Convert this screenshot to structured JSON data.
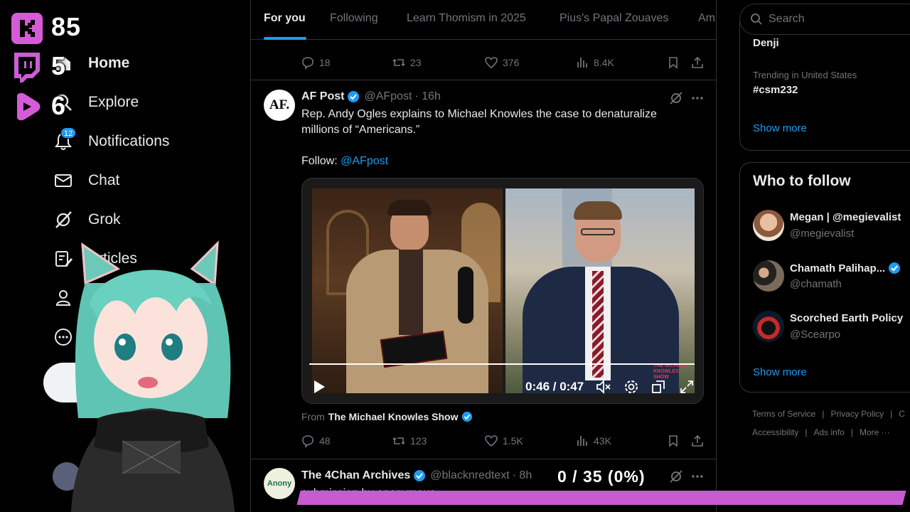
{
  "overlay": {
    "counters": [
      {
        "icon": "kick-icon",
        "color": "#d65bd8",
        "value": "85"
      },
      {
        "icon": "twitch-icon",
        "color": "#c95fd3",
        "value": "5"
      },
      {
        "icon": "rumble-icon",
        "color": "#d65bd8",
        "value": "6"
      }
    ],
    "progress_text": "0 / 35 (0%)",
    "progress_fraction": 0.0,
    "progress_color": "#c65ccf"
  },
  "nav": {
    "items": [
      {
        "label": "Home",
        "icon": "home-icon"
      },
      {
        "label": "Explore",
        "icon": "search-icon"
      },
      {
        "label": "Notifications",
        "icon": "bell-icon",
        "badge": "12"
      },
      {
        "label": "Chat",
        "icon": "mail-icon"
      },
      {
        "label": "Grok",
        "icon": "grok-icon"
      },
      {
        "label": "Articles",
        "icon": "articles-icon"
      },
      {
        "label": "",
        "icon": "profile-icon"
      },
      {
        "label": "",
        "icon": "more-icon"
      }
    ]
  },
  "feed": {
    "tabs": [
      "For you",
      "Following",
      "Learn Thomism in 2025",
      "Pius's Papal Zouaves",
      "Am"
    ],
    "prev_tweet": {
      "replies": "18",
      "reposts": "23",
      "likes": "376",
      "views": "8.4K"
    },
    "tweet": {
      "avatar_text": "AF.",
      "name": "AF Post",
      "handle": "@AFpost",
      "time": "· 16h",
      "text_line1": "Rep. Andy Ogles explains to Michael Knowles the case to denaturalize",
      "text_line2": "millions of “Americans.”",
      "follow_label": "Follow:",
      "follow_link": "@AFpost",
      "video_time": "0:46 / 0:47",
      "video_progress": 0.98,
      "video_watermark": "THE MICHAEL KNOWLES SHOW",
      "from_label": "From",
      "from_source": "The Michael Knowles Show",
      "replies": "48",
      "reposts": "123",
      "likes": "1.5K",
      "views": "43K"
    },
    "next_tweet": {
      "avatar_text": "Anony",
      "name": "The 4Chan Archives",
      "handle": "@blacknredtext",
      "time": "· 8h",
      "text": "submission by anonymous"
    }
  },
  "right": {
    "search_placeholder": "Search",
    "trends": [
      {
        "context": "",
        "name": "Denji"
      },
      {
        "context": "Trending in United States",
        "name": "#csm232"
      }
    ],
    "trends_show_more": "Show more",
    "who_to_follow_title": "Who to follow",
    "who_to_follow": [
      {
        "name": "Megan | @megievalist",
        "handle": "@megievalist",
        "verified": false
      },
      {
        "name": "Chamath Palihap...",
        "handle": "@chamath",
        "verified": true
      },
      {
        "name": "Scorched Earth Policy",
        "handle": "@Scearpo",
        "verified": false
      }
    ],
    "wtf_show_more": "Show more",
    "footer": {
      "row1": [
        "Terms of Service",
        "|",
        "Privacy Policy",
        "|",
        "C"
      ],
      "row2": [
        "Accessibility",
        "|",
        "Ads info",
        "|",
        "More ···"
      ]
    }
  }
}
